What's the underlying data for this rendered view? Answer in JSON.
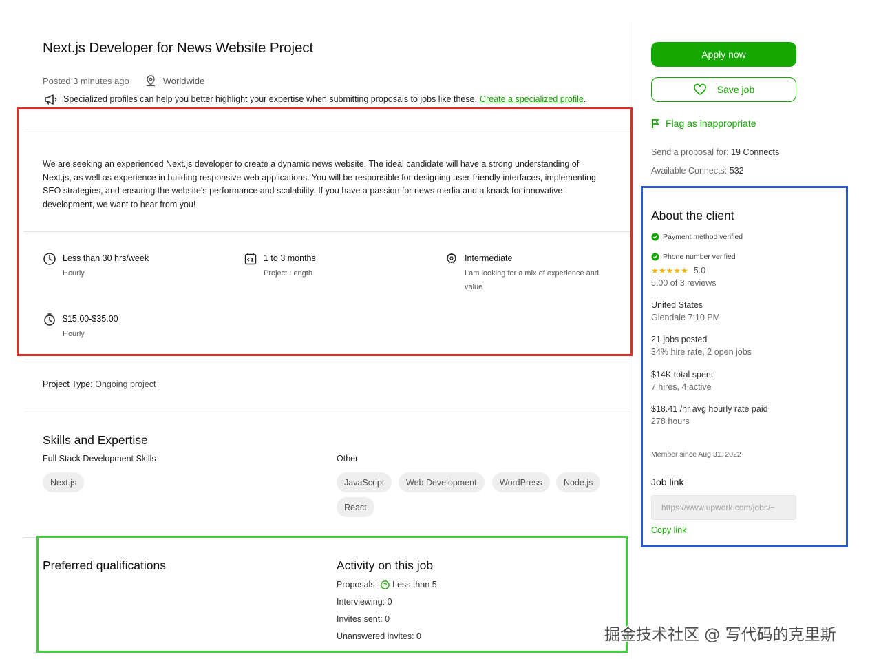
{
  "job": {
    "title": "Next.js Developer for News Website Project",
    "posted": "Posted 3 minutes ago",
    "location": "Worldwide",
    "promo_text": "Specialized profiles can help you better highlight your expertise when submitting proposals to jobs like these.",
    "promo_link": "Create a specialized profile",
    "promo_end": ".",
    "description": "We are seeking an experienced Next.js developer to create a dynamic news website. The ideal candidate will have a strong understanding of Next.js, as well as experience in building responsive web applications. You will be responsible for designing user-friendly interfaces, implementing SEO strategies, and ensuring the website's performance and scalability. If you have a passion for news media and a knack for innovative development, we want to hear from you!",
    "features": {
      "hours": {
        "label": "Less than 30 hrs/week",
        "sub": "Hourly",
        "icon": "clock-icon"
      },
      "length": {
        "label": "1 to 3 months",
        "sub": "Project Length",
        "icon": "calendar-icon"
      },
      "level": {
        "label": "Intermediate",
        "sub": "I am looking for a mix of experience and value",
        "icon": "expertise-icon"
      },
      "rate": {
        "label": "$15.00-$35.00",
        "sub": "Hourly",
        "icon": "stopwatch-icon"
      }
    },
    "project_type_label": "Project Type:",
    "project_type_value": "Ongoing project"
  },
  "skills": {
    "heading": "Skills and Expertise",
    "group1": {
      "label": "Full Stack Development Skills",
      "chips": [
        "Next.js"
      ]
    },
    "group2": {
      "label": "Other",
      "chips": [
        "JavaScript",
        "Web Development",
        "WordPress",
        "Node.js",
        "React"
      ]
    }
  },
  "preferred": {
    "heading": "Preferred qualifications"
  },
  "activity": {
    "heading": "Activity on this job",
    "proposals_label": "Proposals:",
    "proposals_value": "Less than 5",
    "interviewing": "Interviewing: 0",
    "invites": "Invites sent: 0",
    "unanswered": "Unanswered invites: 0"
  },
  "sidebar": {
    "apply_label": "Apply now",
    "save_label": "Save job",
    "flag_label": "Flag as inappropriate",
    "send_proposal_label": "Send a proposal for:",
    "send_proposal_value": "19 Connects",
    "available_label": "Available Connects:",
    "available_value": "532"
  },
  "client": {
    "heading": "About the client",
    "payment": "Payment method verified",
    "phone": "Phone number verified",
    "stars": "★★★★★",
    "rating": "5.0",
    "reviews": "5.00 of 3 reviews",
    "country": "United States",
    "city_time": "Glendale 7:10 PM",
    "jobs_posted": "21 jobs posted",
    "hire_rate": "34% hire rate, 2 open jobs",
    "total_spent": "$14K total spent",
    "hires": "7 hires, 4 active",
    "avg_rate": "$18.41 /hr avg hourly rate paid",
    "hours": "278 hours",
    "member_since": "Member since Aug 31, 2022",
    "job_link_heading": "Job link",
    "job_link_value": "https://www.upwork.com/jobs/~",
    "copy_link": "Copy link"
  },
  "watermark": "掘金技术社区 @ 写代码的克里斯",
  "colors": {
    "accent": "#14a800",
    "red_box": "#d9322b",
    "blue_box": "#2a58c9",
    "green_box": "#46c93c",
    "star": "#f0b400"
  }
}
